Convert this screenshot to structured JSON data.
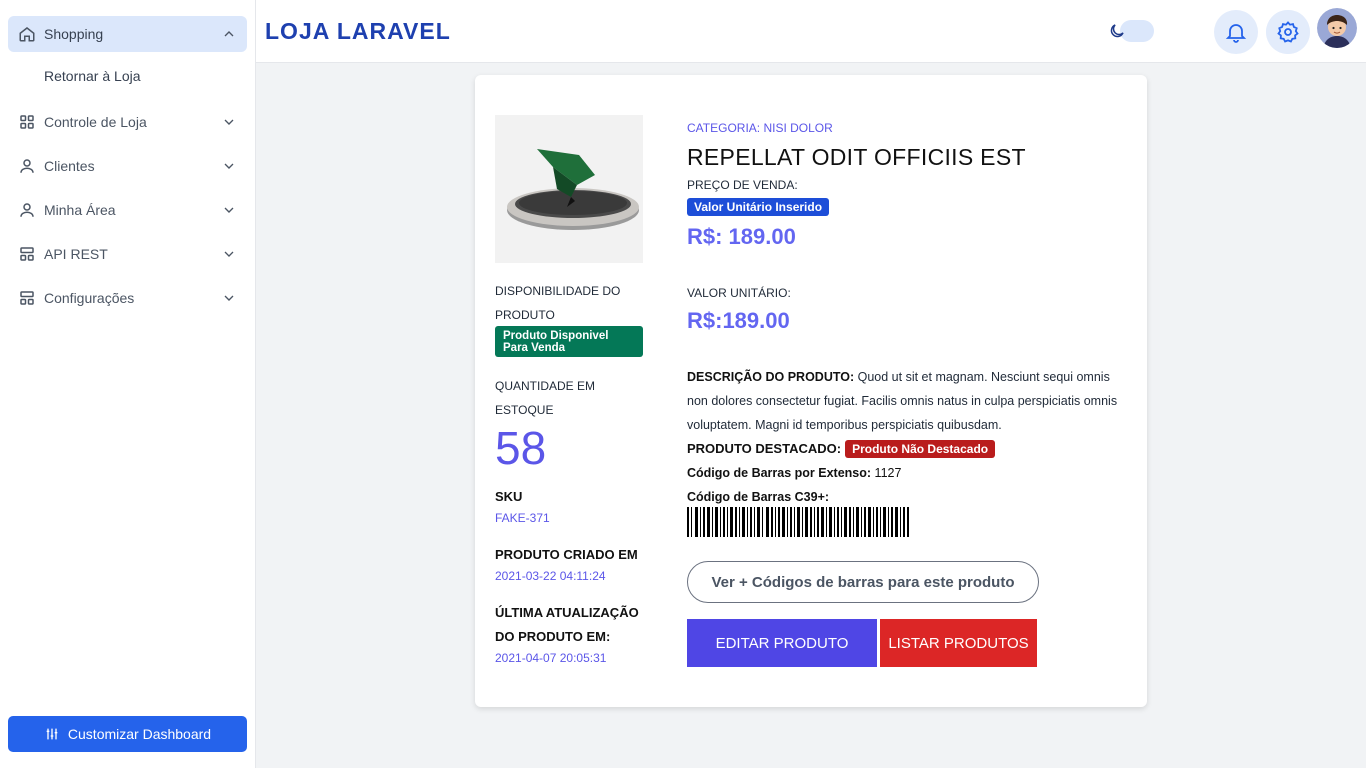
{
  "sidebar": {
    "items": [
      {
        "label": "Shopping",
        "icon": "home-icon",
        "expanded": true
      },
      {
        "label": "Controle de Loja",
        "icon": "grid-icon"
      },
      {
        "label": "Clientes",
        "icon": "user-icon"
      },
      {
        "label": "Minha Área",
        "icon": "user-icon"
      },
      {
        "label": "API REST",
        "icon": "layout-icon"
      },
      {
        "label": "Configurações",
        "icon": "layout-icon"
      }
    ],
    "sub_item": "Retornar à Loja",
    "customize_label": "Customizar Dashboard"
  },
  "header": {
    "brand": "LOJA LARAVEL",
    "icons": [
      "moon-icon",
      "bell-icon",
      "search-icon",
      "gear-icon"
    ]
  },
  "product": {
    "category": "CATEGORIA: NISI DOLOR",
    "name": "REPELLAT ODIT OFFICIIS EST",
    "sale_price_label": "PREÇO DE VENDA:",
    "unit_badge": "Valor Unitário Inserido",
    "sale_price": "R$: 189.00",
    "unit_value_label": "VALOR UNITÁRIO:",
    "unit_value": "R$:189.00",
    "availability_label_1": "DISPONIBILIDADE DO",
    "availability_label_2": "PRODUTO",
    "availability_badge_1": "Produto Disponivel",
    "availability_badge_2": "Para Venda",
    "stock_label_1": "QUANTIDADE EM",
    "stock_label_2": "ESTOQUE",
    "stock_qty": "58",
    "sku_label": "SKU",
    "sku": "FAKE-371",
    "created_label": "PRODUTO CRIADO EM",
    "created_at": "2021-03-22 04:11:24",
    "updated_label_1": "ÚLTIMA ATUALIZAÇÃO",
    "updated_label_2": "DO PRODUTO EM:",
    "updated_at": "2021-04-07 20:05:31",
    "description_label": "DESCRIÇÃO DO PRODUTO:",
    "description": "Quod ut sit et magnam. Nesciunt sequi omnis non dolores consectetur fugiat. Facilis omnis natus in culpa perspiciatis omnis voluptatem. Magni id temporibus perspiciatis quibusdam.",
    "featured_label": "PRODUTO DESTACADO:",
    "featured_badge": "Produto Não Destacado",
    "barcode_ext_label": "Código de Barras por Extenso:",
    "barcode_ext": "1127",
    "barcode_c39_label": "Código de Barras C39+:",
    "more_barcodes": "Ver + Códigos de barras para este produto",
    "edit_label": "EDITAR PRODUTO",
    "list_label": "LISTAR PRODUTOS"
  },
  "colors": {
    "accent": "#2563eb",
    "brand": "#1e40af",
    "price": "#6366f1",
    "success": "#047857",
    "danger": "#b91c1c",
    "edit": "#4f46e5",
    "list": "#dc2626"
  }
}
